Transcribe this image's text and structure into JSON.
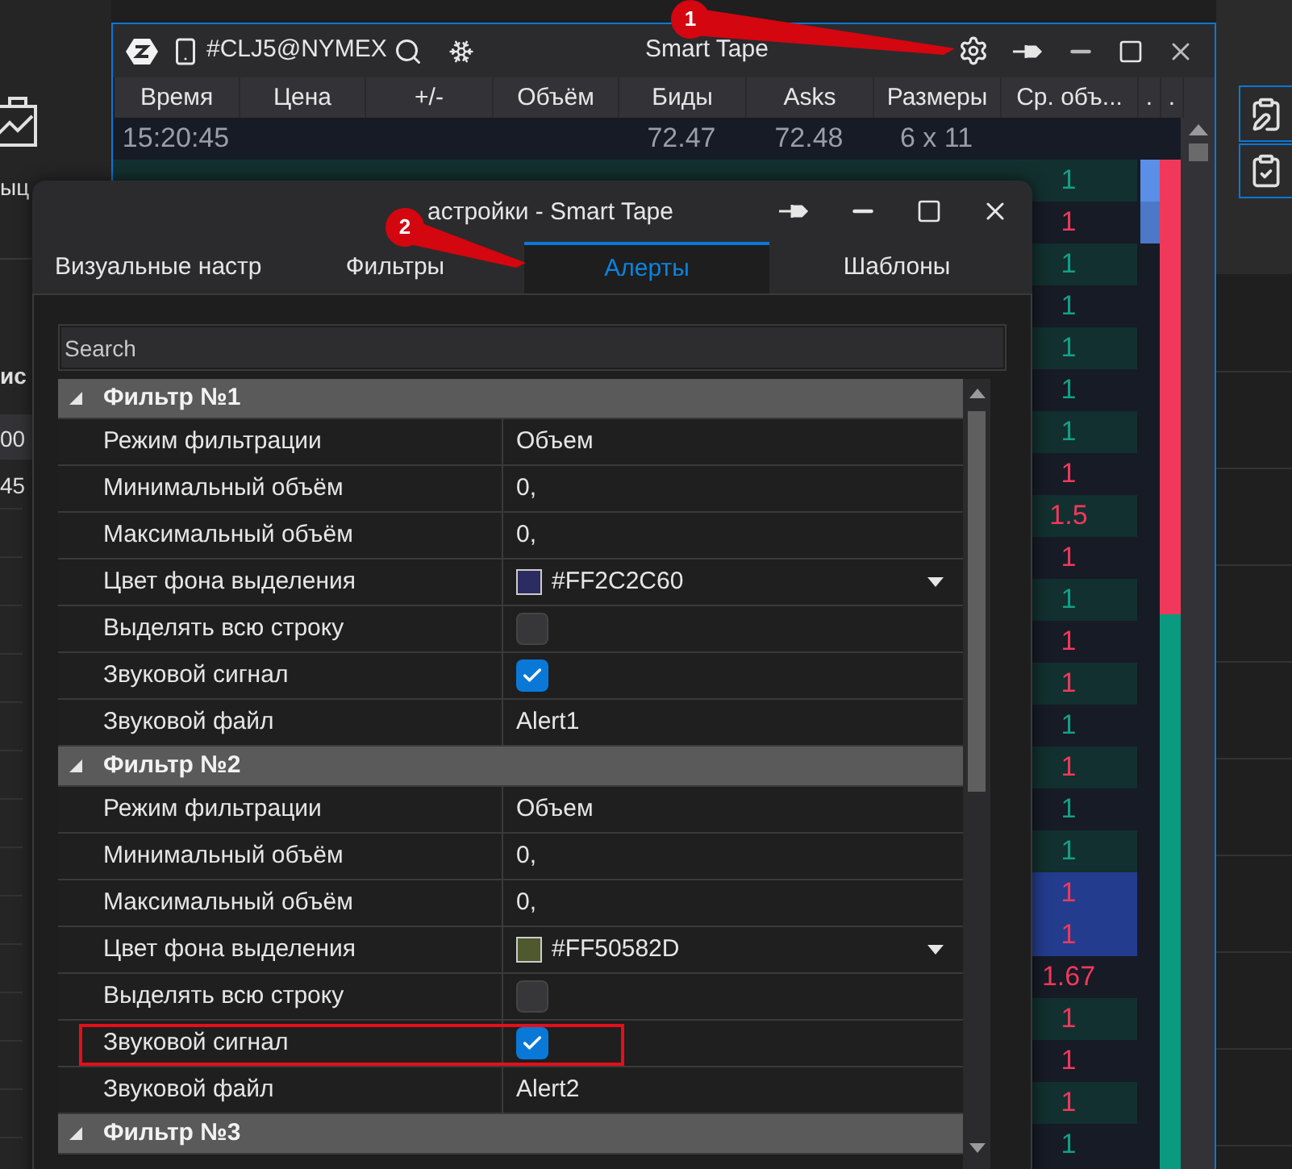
{
  "background_app": {
    "labels": [
      "ыц",
      "ис",
      "00",
      "45"
    ]
  },
  "tape_window": {
    "instrument": "#CLJ5@NYMEX",
    "title": "Smart Tape",
    "columns": [
      "Время",
      "Цена",
      "+/-",
      "Объём",
      "Биды",
      "Asks",
      "Размеры",
      "Ср. объ...",
      ".",
      "."
    ],
    "quote_row": {
      "time": "15:20:45",
      "bid": "72.47",
      "ask": "72.48",
      "sizes": "6 x 11"
    },
    "trades": [
      {
        "avg": "1",
        "rising": true,
        "highlight": false
      },
      {
        "avg": "1",
        "rising": false,
        "highlight": false
      },
      {
        "avg": "1",
        "rising": true,
        "highlight": false
      },
      {
        "avg": "1",
        "rising": true,
        "highlight": false
      },
      {
        "avg": "1",
        "rising": true,
        "highlight": false
      },
      {
        "avg": "1",
        "rising": true,
        "highlight": false
      },
      {
        "avg": "1",
        "rising": true,
        "highlight": false
      },
      {
        "avg": "1",
        "rising": false,
        "highlight": false
      },
      {
        "avg": "1.5",
        "rising": false,
        "highlight": false
      },
      {
        "avg": "1",
        "rising": false,
        "highlight": false
      },
      {
        "avg": "1",
        "rising": true,
        "highlight": false
      },
      {
        "avg": "1",
        "rising": false,
        "highlight": false
      },
      {
        "avg": "1",
        "rising": false,
        "highlight": false
      },
      {
        "avg": "1",
        "rising": true,
        "highlight": false
      },
      {
        "avg": "1",
        "rising": false,
        "highlight": false
      },
      {
        "avg": "1",
        "rising": true,
        "highlight": false
      },
      {
        "avg": "1",
        "rising": true,
        "highlight": false
      },
      {
        "avg": "1",
        "rising": false,
        "highlight": true
      },
      {
        "avg": "1",
        "rising": false,
        "highlight": true
      },
      {
        "avg": "1.67",
        "rising": false,
        "highlight": false
      },
      {
        "avg": "1",
        "rising": false,
        "highlight": false
      },
      {
        "avg": "1",
        "rising": false,
        "highlight": false
      },
      {
        "avg": "1",
        "rising": false,
        "highlight": false
      },
      {
        "avg": "1",
        "rising": true,
        "highlight": false
      }
    ]
  },
  "dialog": {
    "title": "астройки - Smart Tape",
    "tabs": [
      {
        "label": "Визуальные настр",
        "selected": false
      },
      {
        "label": "Фильтры",
        "selected": false
      },
      {
        "label": "Алерты",
        "selected": true
      },
      {
        "label": "Шаблоны",
        "selected": false
      }
    ],
    "search": {
      "placeholder": "Search"
    },
    "groups": [
      {
        "title": "Фильтр №1",
        "expanded": true,
        "rows": [
          {
            "name": "Режим фильтрации",
            "kind": "text",
            "value": "Объем",
            "outlined": false
          },
          {
            "name": "Минимальный объём",
            "kind": "text",
            "value": "0,",
            "outlined": false
          },
          {
            "name": "Максимальный объём",
            "kind": "text",
            "value": "0,",
            "outlined": false
          },
          {
            "name": "Цвет фона выделения",
            "kind": "color",
            "value": "#FF2C2C60",
            "color": "#2c2c60",
            "outlined": false
          },
          {
            "name": "Выделять всю строку",
            "kind": "checkbox",
            "checked": false,
            "outlined": false
          },
          {
            "name": "Звуковой сигнал",
            "kind": "checkbox",
            "checked": true,
            "outlined": false
          },
          {
            "name": "Звуковой файл",
            "kind": "text",
            "value": "Alert1",
            "outlined": false
          }
        ]
      },
      {
        "title": "Фильтр №2",
        "expanded": true,
        "rows": [
          {
            "name": "Режим фильтрации",
            "kind": "text",
            "value": "Объем",
            "outlined": false
          },
          {
            "name": "Минимальный объём",
            "kind": "text",
            "value": "0,",
            "outlined": false
          },
          {
            "name": "Максимальный объём",
            "kind": "text",
            "value": "0,",
            "outlined": false
          },
          {
            "name": "Цвет фона выделения",
            "kind": "color",
            "value": "#FF50582D",
            "color": "#50582d",
            "outlined": false
          },
          {
            "name": "Выделять всю строку",
            "kind": "checkbox",
            "checked": false,
            "outlined": false
          },
          {
            "name": "Звуковой сигнал",
            "kind": "checkbox",
            "checked": true,
            "outlined": true
          },
          {
            "name": "Звуковой файл",
            "kind": "text",
            "value": "Alert2",
            "outlined": false
          }
        ]
      },
      {
        "title": "Фильтр №3",
        "expanded": true
      }
    ]
  },
  "annotations": [
    {
      "label": "1"
    },
    {
      "label": "2"
    }
  ]
}
